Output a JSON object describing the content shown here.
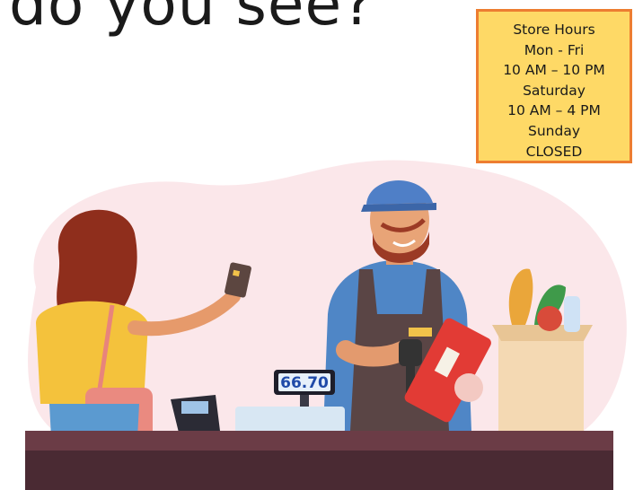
{
  "heading": "do you see?",
  "store_hours": {
    "title": "Store Hours",
    "weekday_label": "Mon - Fri",
    "weekday_hours": "10 AM – 10 PM",
    "saturday_label": "Saturday",
    "saturday_hours": "10 AM – 4 PM",
    "sunday_label": "Sunday",
    "sunday_hours": "CLOSED"
  },
  "register": {
    "price_display": "66.70"
  },
  "colors": {
    "sign_fill": "#fed966",
    "sign_border": "#ed7d31",
    "counter": "#4a2a33",
    "background_blob": "#fbe7ea"
  },
  "icons": [
    "credit-card-icon",
    "barcode-scanner-icon",
    "card-terminal-icon",
    "grocery-bag-icon",
    "cereal-box-icon"
  ]
}
